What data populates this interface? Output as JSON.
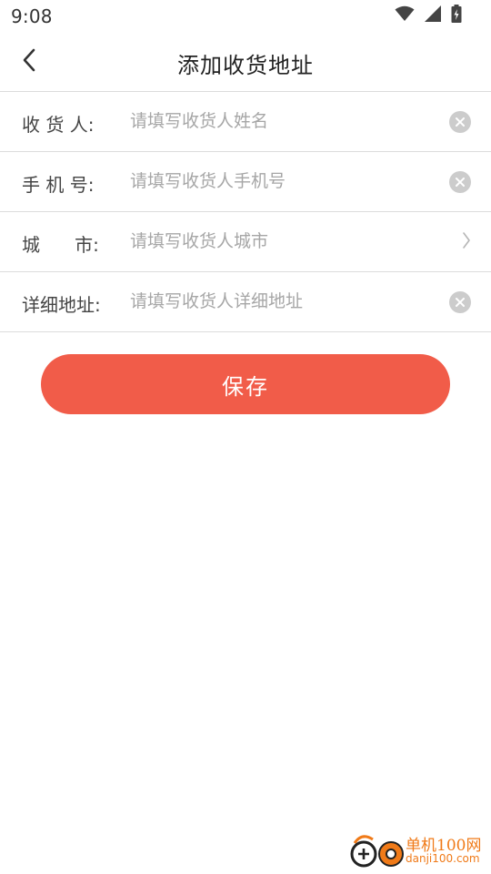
{
  "status_bar": {
    "time": "9:08",
    "icons": [
      "wifi-icon",
      "cell-signal-icon",
      "battery-charging-icon"
    ]
  },
  "header": {
    "title": "添加收货地址",
    "back_icon": "chevron-left-icon"
  },
  "form": {
    "rows": [
      {
        "label": "收 货 人:",
        "value": "",
        "placeholder": "请填写收货人姓名",
        "action_icon": "clear-icon"
      },
      {
        "label": "手 机 号:",
        "value": "",
        "placeholder": "请填写收货人手机号",
        "action_icon": "clear-icon"
      },
      {
        "label": "城      市:",
        "value": "",
        "placeholder": "请填写收货人城市",
        "action_icon": "chevron-right-icon"
      },
      {
        "label": "详细地址:",
        "value": "",
        "placeholder": "请填写收货人详细地址",
        "action_icon": "clear-icon"
      }
    ]
  },
  "save_button": {
    "label": "保存"
  },
  "watermark": {
    "text": "单机100网",
    "subtext": "danji100.com"
  },
  "colors": {
    "accent": "#f15c49",
    "divider": "#dcdcdc",
    "placeholder": "#a6a6a6",
    "clear_icon": "#cccccc",
    "watermark": "#f07a18"
  }
}
